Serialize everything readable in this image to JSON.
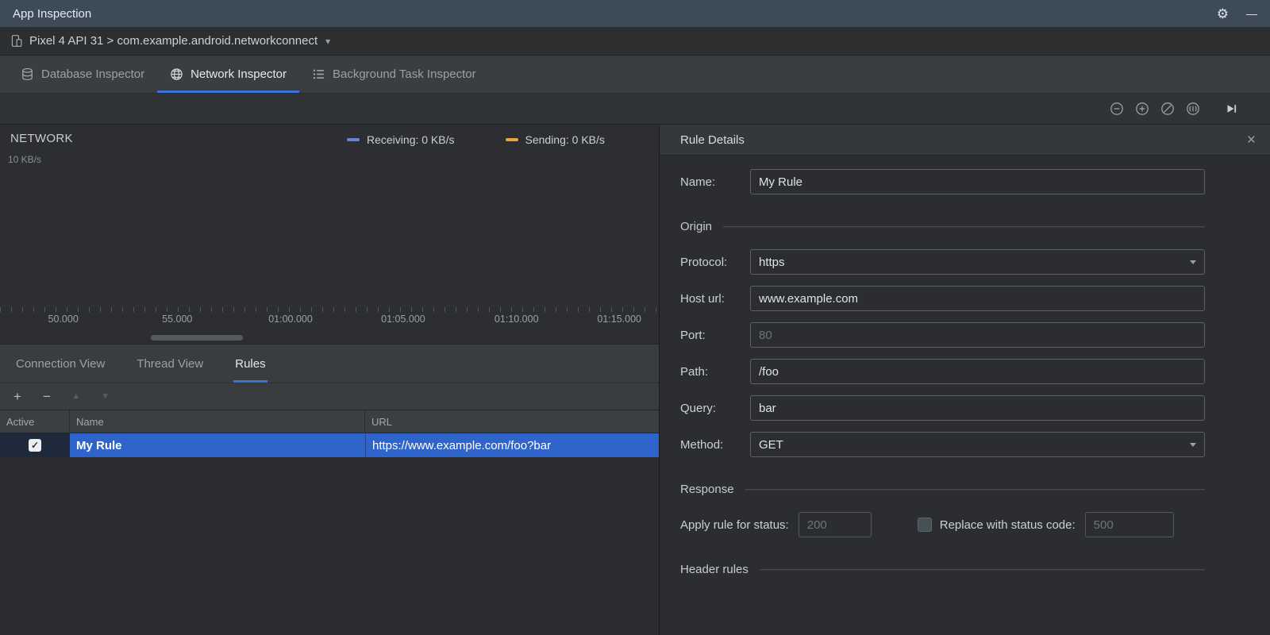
{
  "window": {
    "title": "App Inspection"
  },
  "icons": {
    "gear": "⚙",
    "minimize": "—",
    "chevron_down": "▾",
    "close": "×",
    "plus": "+",
    "minus": "−",
    "arrow_up": "▲",
    "arrow_down": "▼",
    "check": "✓"
  },
  "colors": {
    "accent_underline": "#3D72D8",
    "selection_blue": "#2F65CA",
    "receiving": "#6584D8",
    "sending": "#E8A33D"
  },
  "device_bar": {
    "label": "Pixel 4 API 31 > com.example.android.networkconnect"
  },
  "inspector_tabs": {
    "database": "Database Inspector",
    "network": "Network Inspector",
    "background": "Background Task Inspector"
  },
  "chart": {
    "title": "NETWORK",
    "y_tick": "10 KB/s",
    "legend": [
      {
        "label": "Receiving: 0 KB/s",
        "color": "#6584D8"
      },
      {
        "label": "Sending: 0 KB/s",
        "color": "#E8A33D"
      }
    ],
    "x_ticks": [
      "50.000",
      "55.000",
      "01:00.000",
      "01:05.000",
      "01:10.000",
      "01:15.000"
    ]
  },
  "chart_data": {
    "type": "line",
    "x": [
      "50.000",
      "55.000",
      "01:00.000",
      "01:05.000",
      "01:10.000",
      "01:15.000"
    ],
    "series": [
      {
        "name": "Receiving",
        "values": [
          0,
          0,
          0,
          0,
          0,
          0
        ]
      },
      {
        "name": "Sending",
        "values": [
          0,
          0,
          0,
          0,
          0,
          0
        ]
      }
    ],
    "ylabel": "KB/s",
    "ylim": [
      0,
      10
    ],
    "legend_position": "top"
  },
  "view_tabs": {
    "connection": "Connection View",
    "thread": "Thread View",
    "rules": "Rules"
  },
  "rules_table": {
    "columns": [
      "Active",
      "Name",
      "URL"
    ],
    "row": {
      "active": true,
      "name": "My Rule",
      "url": "https://www.example.com/foo?bar"
    }
  },
  "rule_details": {
    "title": "Rule Details",
    "name": {
      "label": "Name:",
      "value": "My Rule"
    },
    "sections": {
      "origin": "Origin",
      "response": "Response",
      "header_rules": "Header rules"
    },
    "origin": {
      "protocol": {
        "label": "Protocol:",
        "value": "https"
      },
      "host": {
        "label": "Host url:",
        "value": "www.example.com"
      },
      "port": {
        "label": "Port:",
        "placeholder": "80"
      },
      "path": {
        "label": "Path:",
        "value": "/foo"
      },
      "query": {
        "label": "Query:",
        "value": "bar"
      },
      "method": {
        "label": "Method:",
        "value": "GET"
      }
    },
    "response": {
      "apply_label": "Apply rule for status:",
      "apply_placeholder": "200",
      "replace_label": "Replace with status code:",
      "replace_placeholder": "500"
    }
  }
}
